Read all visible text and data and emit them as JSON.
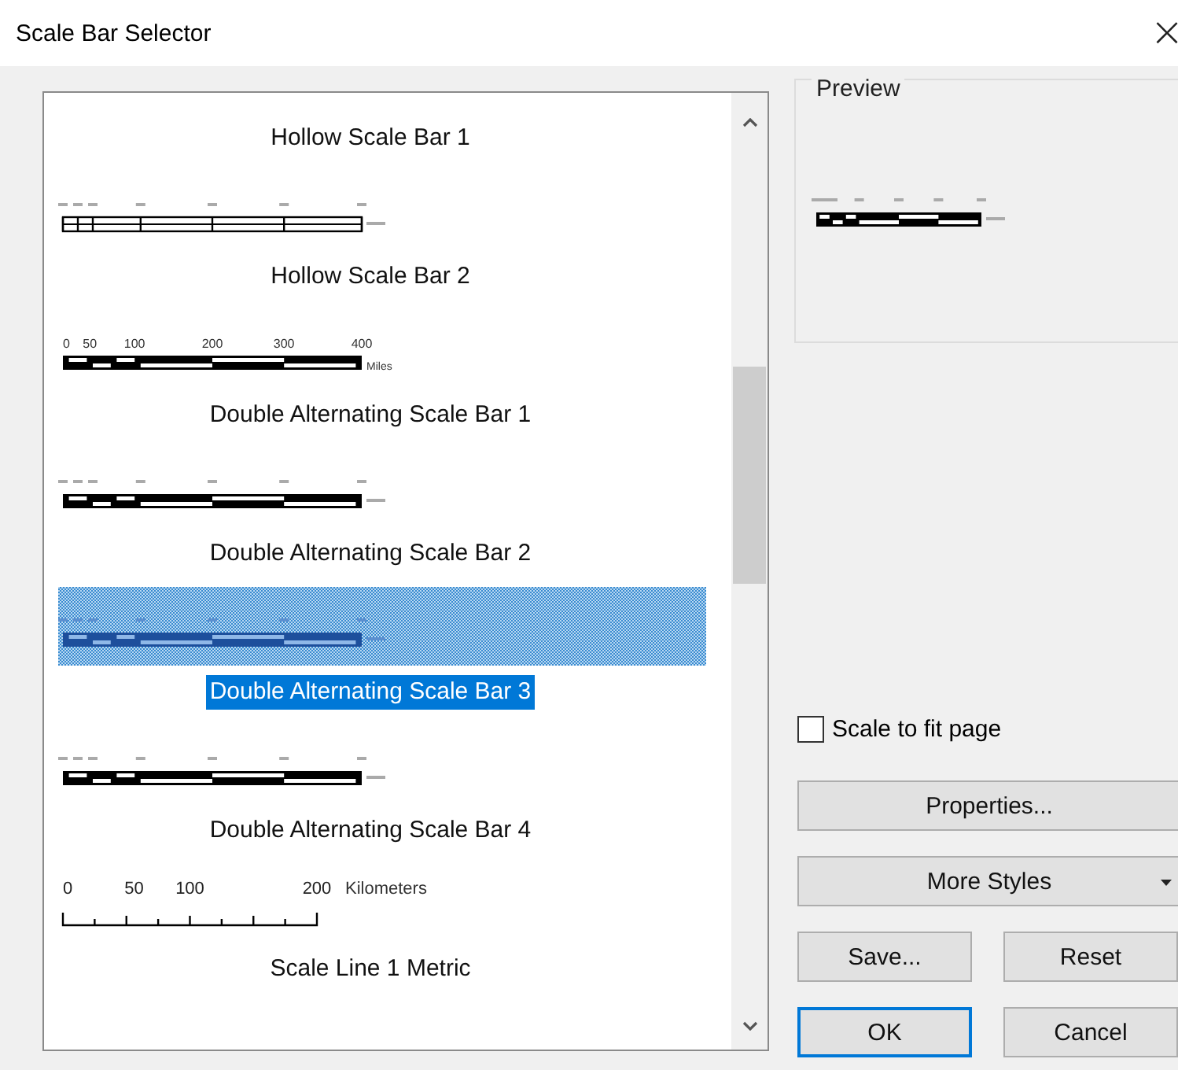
{
  "window": {
    "title": "Scale Bar Selector",
    "close": "×"
  },
  "styles": [
    {
      "label": "Hollow Scale Bar 1",
      "selected": false
    },
    {
      "sample": {
        "kind": "hollow"
      },
      "label": "Hollow Scale Bar 2",
      "selected": false
    },
    {
      "sample": {
        "kind": "double",
        "ticks": [
          "0",
          "50",
          "100",
          "200",
          "300",
          "400"
        ],
        "unit": "Miles"
      },
      "label": "Double Alternating Scale Bar 1",
      "selected": false
    },
    {
      "sample": {
        "kind": "double"
      },
      "label": "Double Alternating Scale Bar 2",
      "selected": false
    },
    {
      "sample": {
        "kind": "double"
      },
      "label": "Double Alternating Scale Bar 3",
      "selected": true
    },
    {
      "sample": {
        "kind": "double"
      },
      "label": "Double Alternating Scale Bar 4",
      "selected": false
    },
    {
      "sample": {
        "kind": "line",
        "ticks": [
          "0",
          "50",
          "100",
          "200"
        ],
        "unit": "Kilometers"
      },
      "label": "Scale Line 1 Metric",
      "selected": false
    }
  ],
  "preview": {
    "title": "Preview",
    "sample": {
      "kind": "double"
    }
  },
  "scale_to_fit": {
    "label": "Scale to fit page",
    "checked": false
  },
  "buttons": {
    "properties": "Properties...",
    "more_styles": "More Styles",
    "save": "Save...",
    "reset": "Reset",
    "ok": "OK",
    "cancel": "Cancel"
  }
}
